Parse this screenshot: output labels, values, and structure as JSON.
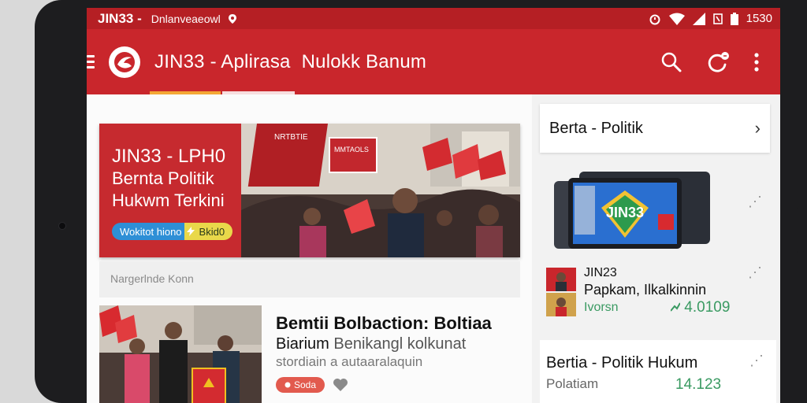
{
  "statusbar": {
    "title": "JIN33 -",
    "subtitle": "Dnlanveaeowl",
    "time": "1530",
    "icons": [
      "location-icon",
      "alarm-icon",
      "wifi-icon",
      "signal-icon",
      "battery-icon"
    ]
  },
  "appbar": {
    "title_part1": "JIN33 - Aplirasa",
    "title_part2": "Nulokk Banum",
    "actions": [
      "search-icon",
      "refresh-icon",
      "more-vert-icon"
    ]
  },
  "hero": {
    "line1": "JIN33 - LPH0",
    "line2": "Bernta Politik",
    "line3": "Hukwm Terkini",
    "button_label": "Wokitot hiono",
    "button_suffix": "Bkid0",
    "caption": "Nargerlnde Konn",
    "flag_text_1": "NRTBTIE",
    "flag_text_2": "MMTAOLS"
  },
  "article": {
    "title": "Bemtii Bolbaction: Boltiaa",
    "subtitle_bold": "Biarium",
    "subtitle_muted": "Benikangl kolkunat",
    "meta": "stordiain a autaaralaquin",
    "badge": "Soda"
  },
  "sidebar": {
    "header": "Berta - Politik",
    "card2_line1": "JIN23",
    "card2_line2": "Papkam, Ilkalkinnin",
    "card2_line3": "Ivorsn",
    "card2_number": "4.0109",
    "card3_title": "Bertia - Politik Hukum",
    "card3_sub": "Polatiam",
    "card3_number": "14.123",
    "tablet_logo": "JIN33"
  },
  "colors": {
    "brand_red": "#c9262c",
    "status_red": "#b51f24",
    "accent_green": "#3a9a62",
    "tab_orange": "#f3a735"
  }
}
